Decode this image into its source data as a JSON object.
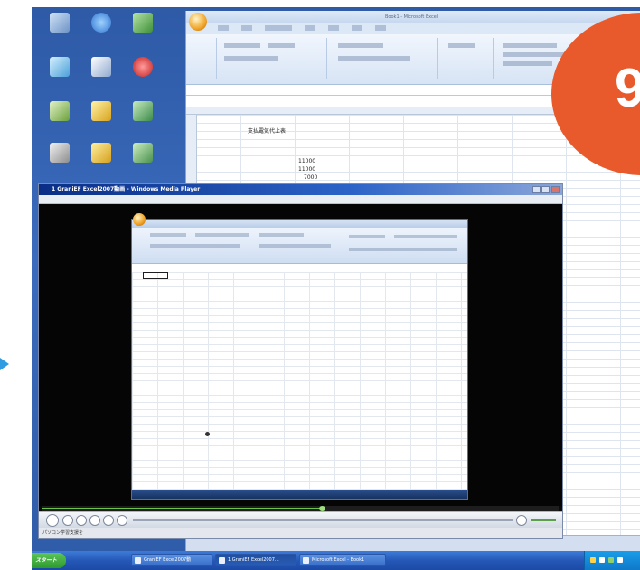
{
  "badge": {
    "text": "9"
  },
  "background_excel": {
    "title": "Book1 - Microsoft Excel",
    "cells": {
      "b2": "支払電気代上表",
      "c5": "11000",
      "c6": "11000",
      "c7": "7000"
    }
  },
  "media_player": {
    "title": "1 GraniEF Excel2007動画 - Windows Media Player",
    "status": "パソコン学習支援を"
  },
  "taskbar": {
    "start_label": "スタート",
    "items": [
      {
        "label": "GraniEF Excel2007動"
      },
      {
        "label": "1 GraniEF Excel2007..."
      },
      {
        "label": "Microsoft Excel - Book1"
      }
    ]
  },
  "icons": {
    "desktop": [
      "my-computer-icon",
      "internet-explorer-icon",
      "network-icon",
      "user-folder-icon",
      "windows-media-player-icon",
      "recycle-bin-icon",
      "office-icon",
      "messenger-icon",
      "shortcut-icon",
      "office-help-icon",
      "excel-file-icon",
      "folder-icon"
    ],
    "arrow": "arrow-right-icon"
  },
  "colors": {
    "badge": "#e85a2c",
    "desktop": "#3b6bbd",
    "taskbar": "#2558b7",
    "start": "#2e9a2e",
    "player_video": "#050505",
    "arrow": "#2f9be0"
  }
}
